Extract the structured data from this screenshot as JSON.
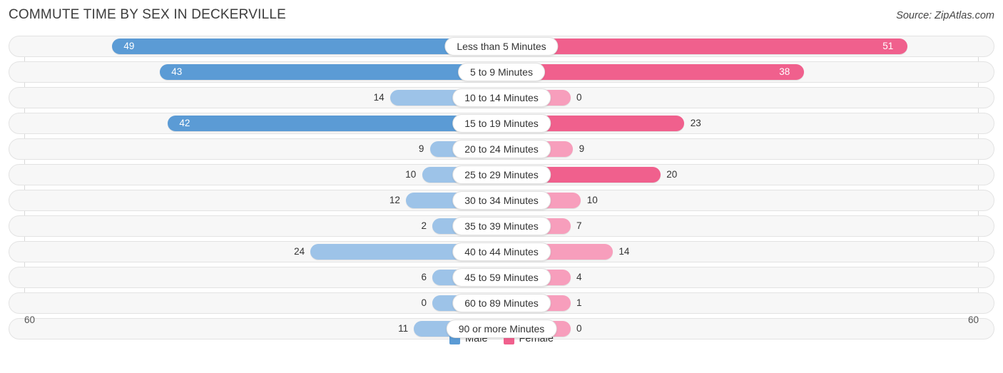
{
  "header": {
    "title": "COMMUTE TIME BY SEX IN DECKERVILLE",
    "source": "Source: ZipAtlas.com"
  },
  "axis": {
    "left_tick": "60",
    "right_tick": "60"
  },
  "legend": {
    "items": [
      {
        "label": "Male",
        "color": "#5b9bd5",
        "icon": "square-swatch-icon"
      },
      {
        "label": "Female",
        "color": "#f0608d",
        "icon": "square-swatch-icon"
      }
    ]
  },
  "chart_data": {
    "type": "bar",
    "orientation": "horizontal-diverging",
    "title": "COMMUTE TIME BY SEX IN DECKERVILLE",
    "subtitle": "",
    "xlabel": "",
    "ylabel": "",
    "xlim": [
      60,
      60
    ],
    "axis_max": 60,
    "grid": true,
    "legend_position": "bottom-center",
    "categories": [
      "Less than 5 Minutes",
      "5 to 9 Minutes",
      "10 to 14 Minutes",
      "15 to 19 Minutes",
      "20 to 24 Minutes",
      "25 to 29 Minutes",
      "30 to 34 Minutes",
      "35 to 39 Minutes",
      "40 to 44 Minutes",
      "45 to 59 Minutes",
      "60 to 89 Minutes",
      "90 or more Minutes"
    ],
    "series": [
      {
        "name": "Male",
        "color": "#5b9bd5",
        "color_light": "#9dc3e8",
        "values": [
          49,
          43,
          14,
          42,
          9,
          10,
          12,
          2,
          24,
          6,
          0,
          11
        ]
      },
      {
        "name": "Female",
        "color": "#f0608d",
        "color_light": "#f79ebc",
        "values": [
          51,
          38,
          0,
          23,
          9,
          20,
          10,
          7,
          14,
          4,
          1,
          0
        ]
      }
    ],
    "rows": [
      {
        "category": "Less than 5 Minutes",
        "male": 49,
        "female": 51,
        "male_label": "49",
        "female_label": "51",
        "male_inside": true,
        "female_inside": true,
        "male_strong": true,
        "female_strong": true
      },
      {
        "category": "5 to 9 Minutes",
        "male": 43,
        "female": 38,
        "male_label": "43",
        "female_label": "38",
        "male_inside": true,
        "female_inside": true,
        "male_strong": true,
        "female_strong": true
      },
      {
        "category": "10 to 14 Minutes",
        "male": 14,
        "female": 0,
        "male_label": "14",
        "female_label": "0",
        "male_inside": false,
        "female_inside": false,
        "male_strong": false,
        "female_strong": false
      },
      {
        "category": "15 to 19 Minutes",
        "male": 42,
        "female": 23,
        "male_label": "42",
        "female_label": "23",
        "male_inside": true,
        "female_inside": false,
        "male_strong": true,
        "female_strong": true
      },
      {
        "category": "20 to 24 Minutes",
        "male": 9,
        "female": 9,
        "male_label": "9",
        "female_label": "9",
        "male_inside": false,
        "female_inside": false,
        "male_strong": false,
        "female_strong": false
      },
      {
        "category": "25 to 29 Minutes",
        "male": 10,
        "female": 20,
        "male_label": "10",
        "female_label": "20",
        "male_inside": false,
        "female_inside": false,
        "male_strong": false,
        "female_strong": true
      },
      {
        "category": "30 to 34 Minutes",
        "male": 12,
        "female": 10,
        "male_label": "12",
        "female_label": "10",
        "male_inside": false,
        "female_inside": false,
        "male_strong": false,
        "female_strong": false
      },
      {
        "category": "35 to 39 Minutes",
        "male": 2,
        "female": 7,
        "male_label": "2",
        "female_label": "7",
        "male_inside": false,
        "female_inside": false,
        "male_strong": false,
        "female_strong": false
      },
      {
        "category": "40 to 44 Minutes",
        "male": 24,
        "female": 14,
        "male_label": "24",
        "female_label": "14",
        "male_inside": false,
        "female_inside": false,
        "male_strong": false,
        "female_strong": false
      },
      {
        "category": "45 to 59 Minutes",
        "male": 6,
        "female": 4,
        "male_label": "6",
        "female_label": "4",
        "male_inside": false,
        "female_inside": false,
        "male_strong": false,
        "female_strong": false
      },
      {
        "category": "60 to 89 Minutes",
        "male": 0,
        "female": 1,
        "male_label": "0",
        "female_label": "1",
        "male_inside": false,
        "female_inside": false,
        "male_strong": false,
        "female_strong": false
      },
      {
        "category": "90 or more Minutes",
        "male": 11,
        "female": 0,
        "male_label": "11",
        "female_label": "0",
        "male_inside": false,
        "female_inside": false,
        "male_strong": false,
        "female_strong": false
      }
    ]
  }
}
